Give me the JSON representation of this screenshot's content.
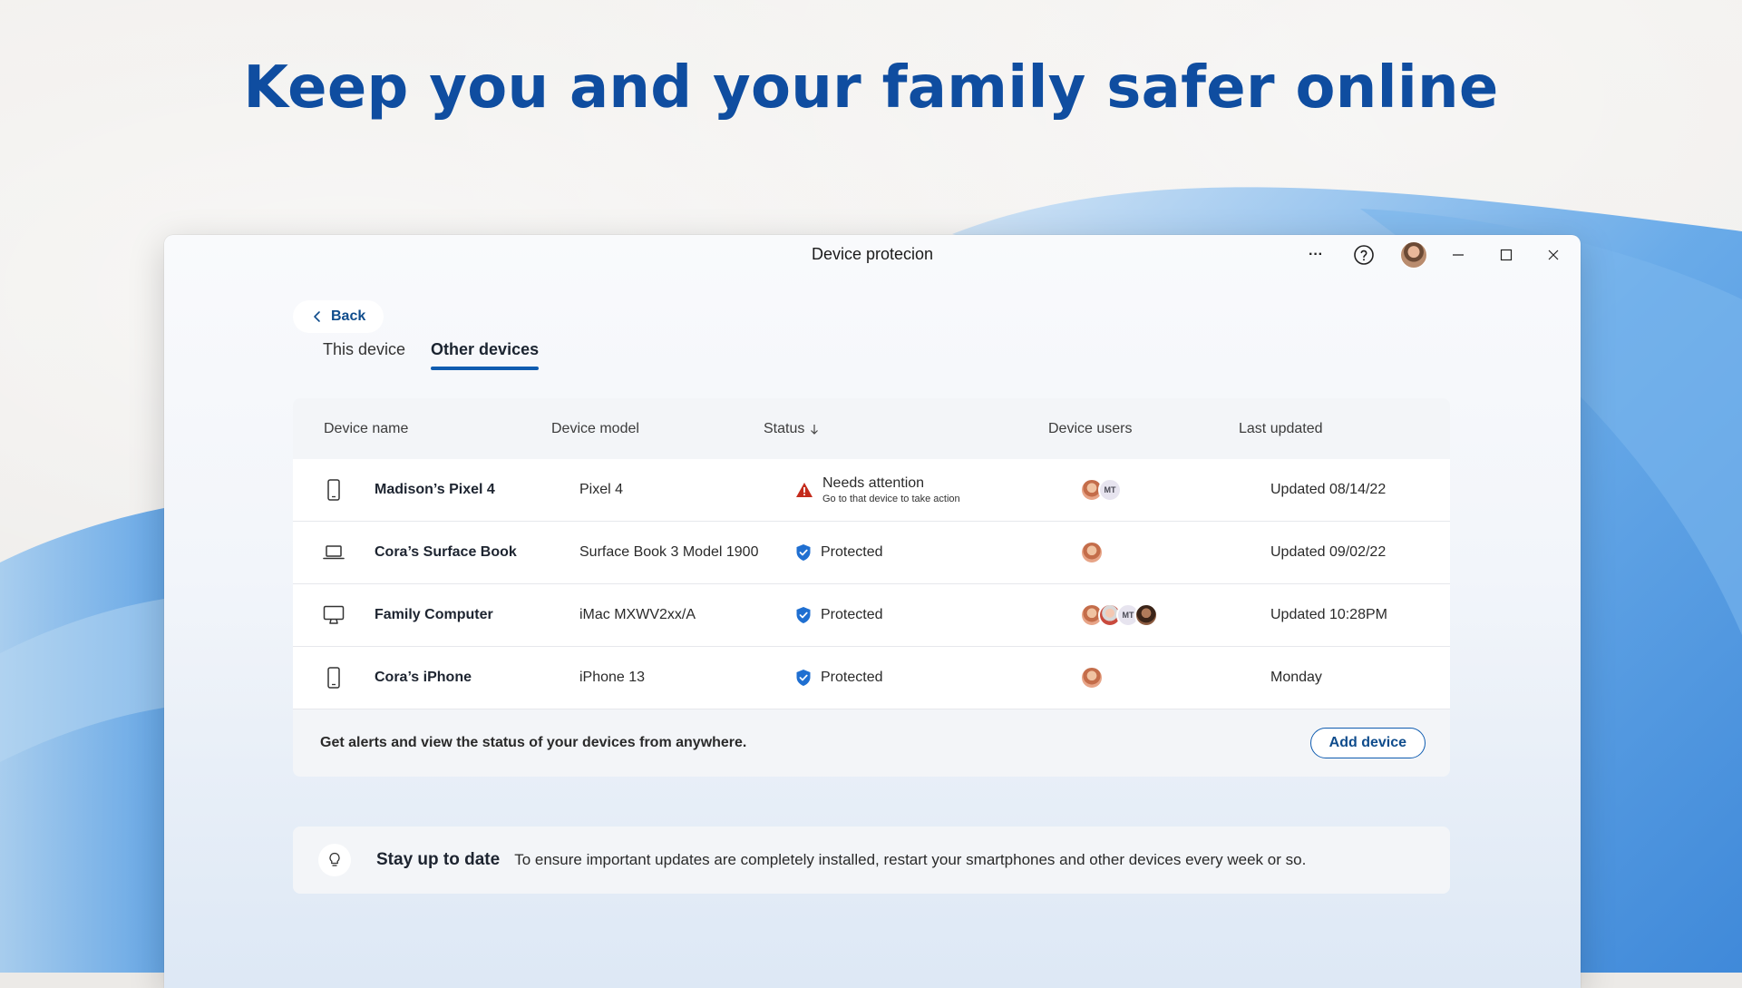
{
  "headline": "Keep you and your family safer online",
  "window": {
    "title": "Device protecion",
    "more_label": "···"
  },
  "back": {
    "label": "Back"
  },
  "tabs": [
    {
      "label": "This device",
      "active": false
    },
    {
      "label": "Other devices",
      "active": true
    }
  ],
  "table": {
    "headers": {
      "name": "Device name",
      "model": "Device model",
      "status": "Status",
      "users": "Device users",
      "updated": "Last updated"
    },
    "rows": [
      {
        "icon": "phone-icon",
        "name": "Madison’s Pixel 4",
        "model": "Pixel 4",
        "status": "Needs attention",
        "status_sub": "Go to that device to take action",
        "status_icon": "warning-icon",
        "users": [
          "photo",
          "MT"
        ],
        "updated": "Updated 08/14/22"
      },
      {
        "icon": "laptop-icon",
        "name": "Cora’s Surface Book",
        "model": "Surface Book 3 Model 1900",
        "status": "Protected",
        "status_icon": "shield-check-icon",
        "users": [
          "photo"
        ],
        "updated": "Updated 09/02/22"
      },
      {
        "icon": "monitor-icon",
        "name": "Family Computer",
        "model": "iMac MXWV2xx/A",
        "status": "Protected",
        "status_icon": "shield-check-icon",
        "users": [
          "photo",
          "photo",
          "MT",
          "photo"
        ],
        "updated": "Updated 10:28PM"
      },
      {
        "icon": "phone-icon",
        "name": "Cora’s iPhone",
        "model": "iPhone 13",
        "status": "Protected",
        "status_icon": "shield-check-icon",
        "users": [
          "photo"
        ],
        "updated": "Monday"
      }
    ],
    "footer_text": "Get alerts and view the status of your devices from anywhere.",
    "add_button": "Add device",
    "mt_initials": "MT"
  },
  "tip": {
    "title": "Stay up to date",
    "body": "To ensure important updates are completely installed, restart your smartphones and other devices every week or so."
  },
  "colors": {
    "brand_blue": "#0f4da0",
    "warning_red": "#c42b1c",
    "shield_blue": "#1f6fd1"
  }
}
